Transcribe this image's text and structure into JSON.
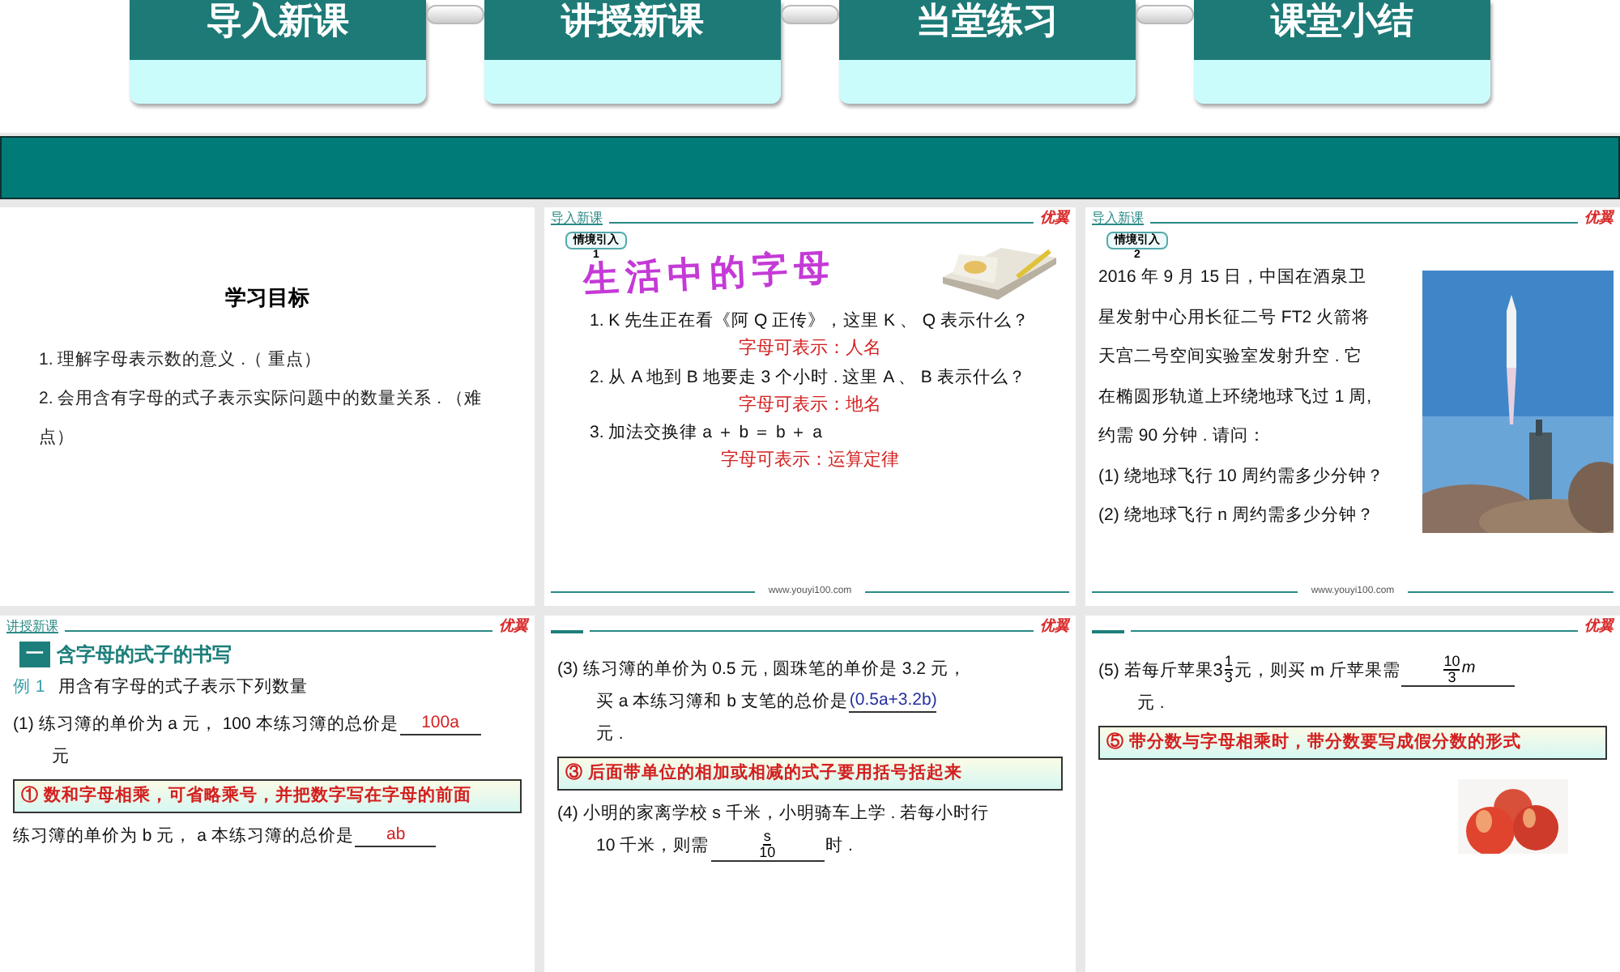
{
  "nav_tabs": [
    {
      "label": "导入新课"
    },
    {
      "label": "讲授新课"
    },
    {
      "label": "当堂练习"
    },
    {
      "label": "课堂小结"
    }
  ],
  "slides": [
    {
      "kind": "objectives",
      "title": "学习目标",
      "items": [
        "1.  理解字母表示数的意义 .（ 重点）",
        "2.  会用含有字母的式子表示实际问题中的数量关系 . （难点）"
      ]
    },
    {
      "kind": "intro",
      "section": "导入新课",
      "logo": "优翼",
      "badge": "情境引入",
      "badge_number": "1",
      "heading": "生活中的字母",
      "questions": [
        {
          "text": "1. K 先生正在看《阿 Q 正传》，这里 K 、 Q 表示什么？",
          "answer": "字母可表示：人名"
        },
        {
          "text": "2.  从 A 地到 B 地要走 3 个小时 .  这里 A 、 B 表示什么？",
          "answer": "字母可表示：地名"
        },
        {
          "text": "3.  加法交换律 a ＋ b ＝ b ＋ a",
          "answer": "字母可表示：运算定律"
        }
      ],
      "footer": "www.youyi100.com"
    },
    {
      "kind": "story",
      "section": "导入新课",
      "logo": "优翼",
      "badge": "情境引入",
      "badge_number": "2",
      "lines": [
        "2016 年 9 月 15 日，中国在酒泉卫",
        "星发射中心用长征二号 FT2 火箭将",
        "天宫二号空间实验室发射升空 . 它",
        "在椭圆形轨道上环绕地球飞过 1 周,",
        "约需 90 分钟 . 请问：",
        "(1) 绕地球飞行 10 周约需多少分钟？",
        "(2) 绕地球飞行 n 周约需多少分钟？"
      ],
      "footer": "www.youyi100.com"
    },
    {
      "kind": "lesson",
      "section": "讲授新课",
      "logo": "优翼",
      "section_number": "一",
      "heading": "含字母的式子的书写",
      "example_label": "例 1",
      "example_text": "用含有字母的式子表示下列数量",
      "blocks": [
        {
          "kind": "fill",
          "lines": [
            [
              {
                "kind": "text",
                "text": "(1) 练习簿的单价为 a 元， 100 本练习簿的总价是"
              },
              {
                "kind": "blank",
                "answer": "100a",
                "color": "#d42020"
              }
            ],
            [
              {
                "kind": "text",
                "text": "元"
              }
            ]
          ]
        },
        {
          "kind": "callout",
          "text": "① 数和字母相乘，**可省略乘号**，并把数字写在字母的前面"
        },
        {
          "kind": "fill",
          "lines": [
            [
              {
                "kind": "text",
                "text": "练习簿的单价为 b  元，  a 本练习簿的总价是"
              },
              {
                "kind": "blank",
                "answer": "ab",
                "color": "#d42020"
              }
            ]
          ]
        }
      ]
    },
    {
      "kind": "lesson",
      "logo": "优翼",
      "blocks": [
        {
          "kind": "fill",
          "lines": [
            [
              {
                "kind": "text",
                "text": "(3) 练习簿的单价为 0.5 元 , 圆珠笔的单价是 3.2 元，"
              }
            ],
            [
              {
                "kind": "text",
                "text": "买 a 本练习簿和 b 支笔的总价是"
              },
              {
                "kind": "blank",
                "answer": "(0.5a+3.2b)",
                "color": "#2630a0"
              }
            ],
            [
              {
                "kind": "text",
                "text": "元 ."
              }
            ]
          ]
        },
        {
          "kind": "callout",
          "text": "③ 后面带单位的相加或相减的式子要用括号括起来"
        },
        {
          "kind": "fill",
          "lines": [
            [
              {
                "kind": "text",
                "text": "(4) 小明的家离学校 s 千米，小明骑车上学 . 若每小时行"
              }
            ],
            [
              {
                "kind": "text",
                "text": "10 千米，则需"
              },
              {
                "kind": "fracblank",
                "num": "s",
                "den": "10"
              },
              {
                "kind": "text",
                "text": "时 ."
              }
            ]
          ]
        }
      ]
    },
    {
      "kind": "lesson",
      "logo": "优翼",
      "picture": true,
      "blocks": [
        {
          "kind": "fill",
          "lines": [
            [
              {
                "kind": "text",
                "text": "(5) 若每斤苹果"
              },
              {
                "kind": "frac",
                "whole": "3",
                "num": "1",
                "den": "3"
              },
              {
                "kind": "text",
                "text": "元，则买 m 斤苹果需"
              },
              {
                "kind": "fracblank",
                "num": "10",
                "den": "3",
                "var": "m"
              }
            ],
            [
              {
                "kind": "text",
                "text": "元 ."
              }
            ]
          ]
        },
        {
          "kind": "callout",
          "text": "⑤ 带分数与字母相乘时，带分数要写成假分数的形式"
        }
      ]
    }
  ]
}
